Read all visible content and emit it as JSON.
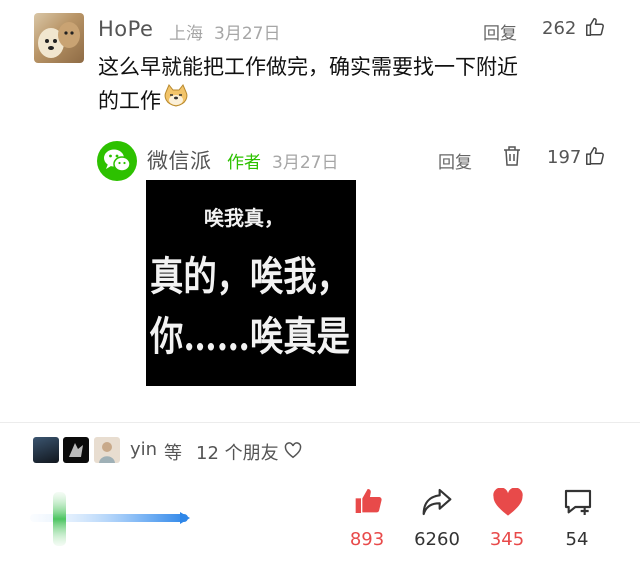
{
  "comment": {
    "username": "HoPe",
    "location": "上海",
    "date": "3月27日",
    "reply_label": "回复",
    "like_count": "262",
    "text_line1": "这么早就能把工作做完，确实需要找一下附近",
    "text_line2": "的工作",
    "emoji": "doge-emoji"
  },
  "reply": {
    "username": "微信派",
    "author_tag": "作者",
    "date": "3月27日",
    "reply_label": "回复",
    "like_count": "197",
    "meme_lines": [
      "唉我真，",
      "真的，唉我，",
      "你……唉真是"
    ]
  },
  "friends": {
    "name": "yin",
    "middle": "等",
    "count_text": "12 个朋友"
  },
  "actions": {
    "likes": "893",
    "shares": "6260",
    "hearts": "345",
    "comments": "54"
  },
  "colors": {
    "accent_red": "#e84a4a",
    "wechat_green": "#2dc100",
    "muted": "#a6a6a6"
  }
}
